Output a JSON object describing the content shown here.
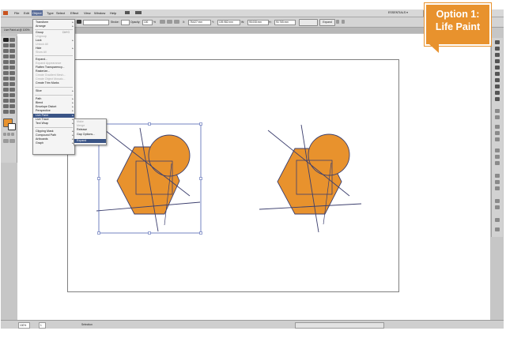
{
  "menubar": {
    "items": [
      "File",
      "Edit",
      "Object",
      "Type",
      "Select",
      "Effect",
      "View",
      "Window",
      "Help"
    ],
    "workspace": "ESSENTIALS ▾"
  },
  "control": {
    "stroke_label": "Stroke:",
    "opacity_label": "Opacity:",
    "opacity_value": "100",
    "x_label": "X:",
    "x_value": "78.627 mm",
    "y_label": "Y:",
    "y_value": "109.982 mm",
    "w_label": "W:",
    "w_value": "95.008 mm",
    "h_label": "H:",
    "h_value": "90.765 mm",
    "expand_label": "Expand"
  },
  "tab": {
    "label": "Live Paint.ai @ 100%"
  },
  "object_menu": {
    "items": [
      {
        "label": "Transform",
        "submenu": true
      },
      {
        "label": "Arrange",
        "submenu": true
      },
      {
        "label": "Group",
        "shortcut": "Ctrl+G"
      },
      {
        "label": "Ungroup",
        "shortcut": "Shift+Ctrl+G",
        "disabled": true
      },
      {
        "label": "Lock",
        "submenu": true
      },
      {
        "label": "Unlock All",
        "disabled": true
      },
      {
        "label": "Hide",
        "submenu": true
      },
      {
        "label": "Show All",
        "disabled": true
      },
      {
        "label": "Expand..."
      },
      {
        "label": "Expand Appearance",
        "disabled": true
      },
      {
        "label": "Flatten Transparency..."
      },
      {
        "label": "Rasterize..."
      },
      {
        "label": "Create Gradient Mesh...",
        "disabled": true
      },
      {
        "label": "Create Object Mosaic...",
        "disabled": true
      },
      {
        "label": "Create Trim Marks"
      },
      {
        "label": "Slice",
        "submenu": true
      },
      {
        "label": "Path",
        "submenu": true
      },
      {
        "label": "Blend",
        "submenu": true
      },
      {
        "label": "Envelope Distort",
        "submenu": true
      },
      {
        "label": "Perspective",
        "submenu": true
      },
      {
        "label": "Live Paint",
        "submenu": true,
        "highlighted": true
      },
      {
        "label": "Live Trace",
        "submenu": true
      },
      {
        "label": "Text Wrap",
        "submenu": true
      },
      {
        "label": "Clipping Mask",
        "submenu": true
      },
      {
        "label": "Compound Path",
        "submenu": true
      },
      {
        "label": "Artboards",
        "submenu": true
      },
      {
        "label": "Graph",
        "submenu": true
      }
    ]
  },
  "live_paint_submenu": {
    "items": [
      {
        "label": "Make",
        "disabled": true
      },
      {
        "label": "Merge",
        "disabled": true
      },
      {
        "label": "Release"
      },
      {
        "label": "Gap Options..."
      },
      {
        "label": "Expand",
        "highlighted": true
      }
    ]
  },
  "statusbar": {
    "zoom": "100%",
    "page": "1",
    "tool": "Selection"
  },
  "callout": {
    "line1": "Option 1:",
    "line2": "Life Paint"
  },
  "colors": {
    "shape_fill": "#e8922d",
    "shape_stroke": "#3c3f6e",
    "menu_highlight": "#3a5486",
    "callout": "#e8922d"
  }
}
